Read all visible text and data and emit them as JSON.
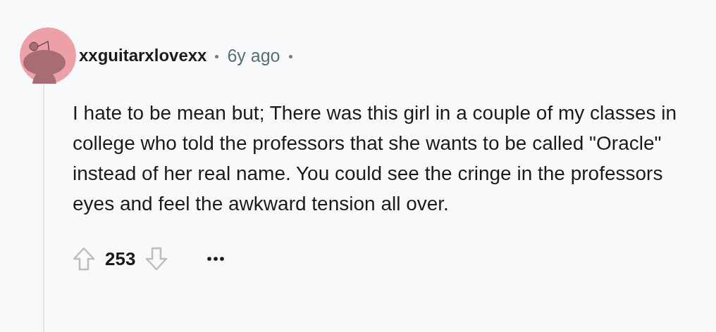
{
  "comment": {
    "author": "xxguitarxlovexx",
    "age": "6y ago",
    "body": "I hate to be mean but; There was this girl in a couple of my classes in college who told the professors that she wants to be called \"Oracle\" instead of her real name. You could see the cringe in the professors eyes and feel the awkward tension all over.",
    "score": "253"
  }
}
